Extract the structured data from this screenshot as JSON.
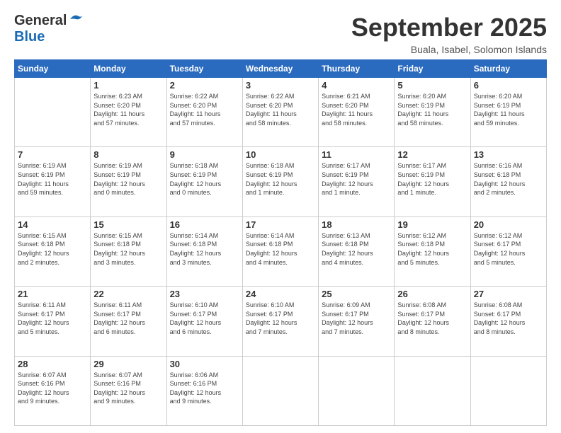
{
  "header": {
    "logo_general": "General",
    "logo_blue": "Blue",
    "month": "September 2025",
    "location": "Buala, Isabel, Solomon Islands"
  },
  "days_of_week": [
    "Sunday",
    "Monday",
    "Tuesday",
    "Wednesday",
    "Thursday",
    "Friday",
    "Saturday"
  ],
  "weeks": [
    [
      {
        "day": "",
        "info": ""
      },
      {
        "day": "1",
        "info": "Sunrise: 6:23 AM\nSunset: 6:20 PM\nDaylight: 11 hours\nand 57 minutes."
      },
      {
        "day": "2",
        "info": "Sunrise: 6:22 AM\nSunset: 6:20 PM\nDaylight: 11 hours\nand 57 minutes."
      },
      {
        "day": "3",
        "info": "Sunrise: 6:22 AM\nSunset: 6:20 PM\nDaylight: 11 hours\nand 58 minutes."
      },
      {
        "day": "4",
        "info": "Sunrise: 6:21 AM\nSunset: 6:20 PM\nDaylight: 11 hours\nand 58 minutes."
      },
      {
        "day": "5",
        "info": "Sunrise: 6:20 AM\nSunset: 6:19 PM\nDaylight: 11 hours\nand 58 minutes."
      },
      {
        "day": "6",
        "info": "Sunrise: 6:20 AM\nSunset: 6:19 PM\nDaylight: 11 hours\nand 59 minutes."
      }
    ],
    [
      {
        "day": "7",
        "info": "Sunrise: 6:19 AM\nSunset: 6:19 PM\nDaylight: 11 hours\nand 59 minutes."
      },
      {
        "day": "8",
        "info": "Sunrise: 6:19 AM\nSunset: 6:19 PM\nDaylight: 12 hours\nand 0 minutes."
      },
      {
        "day": "9",
        "info": "Sunrise: 6:18 AM\nSunset: 6:19 PM\nDaylight: 12 hours\nand 0 minutes."
      },
      {
        "day": "10",
        "info": "Sunrise: 6:18 AM\nSunset: 6:19 PM\nDaylight: 12 hours\nand 1 minute."
      },
      {
        "day": "11",
        "info": "Sunrise: 6:17 AM\nSunset: 6:19 PM\nDaylight: 12 hours\nand 1 minute."
      },
      {
        "day": "12",
        "info": "Sunrise: 6:17 AM\nSunset: 6:19 PM\nDaylight: 12 hours\nand 1 minute."
      },
      {
        "day": "13",
        "info": "Sunrise: 6:16 AM\nSunset: 6:18 PM\nDaylight: 12 hours\nand 2 minutes."
      }
    ],
    [
      {
        "day": "14",
        "info": "Sunrise: 6:15 AM\nSunset: 6:18 PM\nDaylight: 12 hours\nand 2 minutes."
      },
      {
        "day": "15",
        "info": "Sunrise: 6:15 AM\nSunset: 6:18 PM\nDaylight: 12 hours\nand 3 minutes."
      },
      {
        "day": "16",
        "info": "Sunrise: 6:14 AM\nSunset: 6:18 PM\nDaylight: 12 hours\nand 3 minutes."
      },
      {
        "day": "17",
        "info": "Sunrise: 6:14 AM\nSunset: 6:18 PM\nDaylight: 12 hours\nand 4 minutes."
      },
      {
        "day": "18",
        "info": "Sunrise: 6:13 AM\nSunset: 6:18 PM\nDaylight: 12 hours\nand 4 minutes."
      },
      {
        "day": "19",
        "info": "Sunrise: 6:12 AM\nSunset: 6:18 PM\nDaylight: 12 hours\nand 5 minutes."
      },
      {
        "day": "20",
        "info": "Sunrise: 6:12 AM\nSunset: 6:17 PM\nDaylight: 12 hours\nand 5 minutes."
      }
    ],
    [
      {
        "day": "21",
        "info": "Sunrise: 6:11 AM\nSunset: 6:17 PM\nDaylight: 12 hours\nand 5 minutes."
      },
      {
        "day": "22",
        "info": "Sunrise: 6:11 AM\nSunset: 6:17 PM\nDaylight: 12 hours\nand 6 minutes."
      },
      {
        "day": "23",
        "info": "Sunrise: 6:10 AM\nSunset: 6:17 PM\nDaylight: 12 hours\nand 6 minutes."
      },
      {
        "day": "24",
        "info": "Sunrise: 6:10 AM\nSunset: 6:17 PM\nDaylight: 12 hours\nand 7 minutes."
      },
      {
        "day": "25",
        "info": "Sunrise: 6:09 AM\nSunset: 6:17 PM\nDaylight: 12 hours\nand 7 minutes."
      },
      {
        "day": "26",
        "info": "Sunrise: 6:08 AM\nSunset: 6:17 PM\nDaylight: 12 hours\nand 8 minutes."
      },
      {
        "day": "27",
        "info": "Sunrise: 6:08 AM\nSunset: 6:17 PM\nDaylight: 12 hours\nand 8 minutes."
      }
    ],
    [
      {
        "day": "28",
        "info": "Sunrise: 6:07 AM\nSunset: 6:16 PM\nDaylight: 12 hours\nand 9 minutes."
      },
      {
        "day": "29",
        "info": "Sunrise: 6:07 AM\nSunset: 6:16 PM\nDaylight: 12 hours\nand 9 minutes."
      },
      {
        "day": "30",
        "info": "Sunrise: 6:06 AM\nSunset: 6:16 PM\nDaylight: 12 hours\nand 9 minutes."
      },
      {
        "day": "",
        "info": ""
      },
      {
        "day": "",
        "info": ""
      },
      {
        "day": "",
        "info": ""
      },
      {
        "day": "",
        "info": ""
      }
    ]
  ]
}
